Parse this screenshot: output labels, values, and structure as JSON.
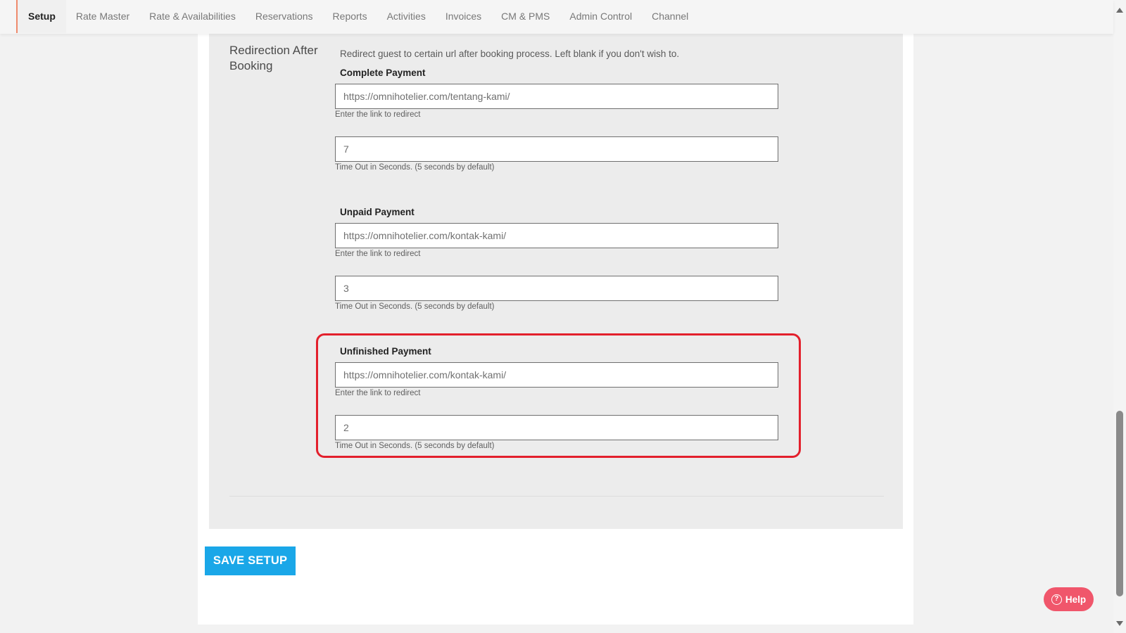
{
  "nav": {
    "tabs": [
      {
        "label": "Setup",
        "active": true
      },
      {
        "label": "Rate Master"
      },
      {
        "label": "Rate & Availabilities"
      },
      {
        "label": "Reservations"
      },
      {
        "label": "Reports"
      },
      {
        "label": "Activities"
      },
      {
        "label": "Invoices"
      },
      {
        "label": "CM & PMS"
      },
      {
        "label": "Admin Control"
      },
      {
        "label": "Channel"
      }
    ]
  },
  "redirection": {
    "title": "Redirection After Booking",
    "description": "Redirect guest to certain url after booking process. Left blank if you don't wish to.",
    "link_help": "Enter the link to redirect",
    "timeout_help": "Time Out in Seconds. (5 seconds by default)",
    "complete": {
      "label": "Complete Payment",
      "url": "https://omnihotelier.com/tentang-kami/",
      "timeout": "7"
    },
    "unpaid": {
      "label": "Unpaid Payment",
      "url": "https://omnihotelier.com/kontak-kami/",
      "timeout": "3"
    },
    "unfinished": {
      "label": "Unfinished Payment",
      "url": "https://omnihotelier.com/kontak-kami/",
      "timeout": "2"
    }
  },
  "actions": {
    "save_label": "SAVE SETUP",
    "help_label": "Help",
    "help_icon": "question-circle-icon"
  },
  "colors": {
    "accent": "#ef8a6c",
    "primary_button": "#1aa7e8",
    "help_button": "#f0566b",
    "highlight": "#e3202c"
  }
}
